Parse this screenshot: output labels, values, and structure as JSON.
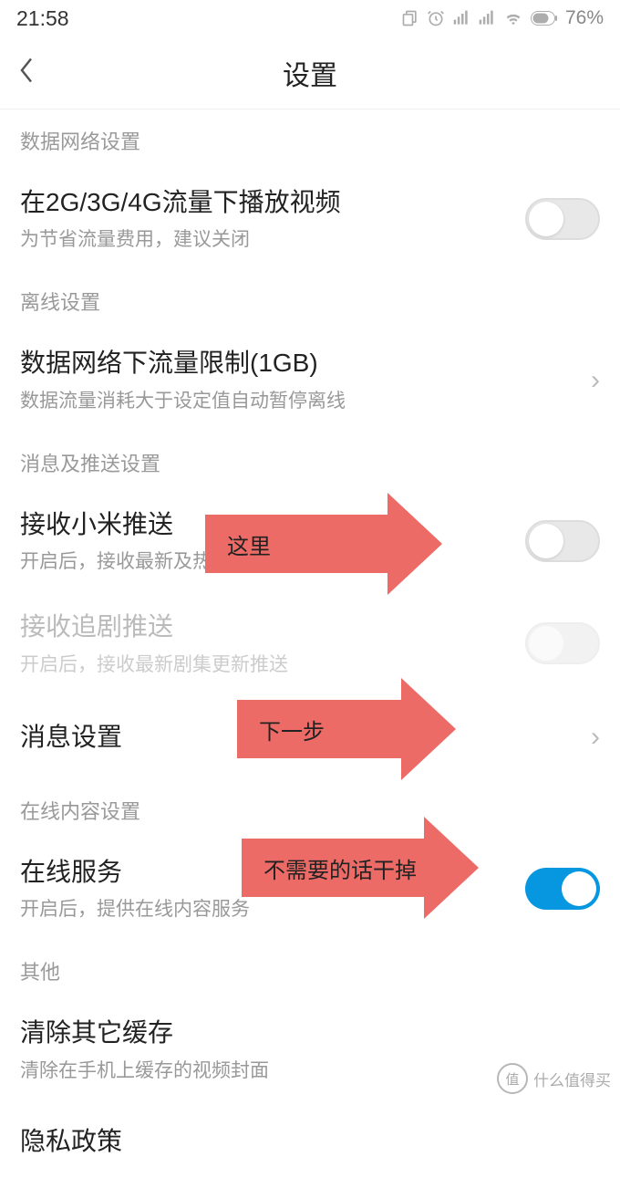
{
  "status": {
    "time": "21:58",
    "battery": "76%"
  },
  "header": {
    "title": "设置"
  },
  "sections": {
    "network": {
      "header": "数据网络设置",
      "mobile_play": {
        "title": "在2G/3G/4G流量下播放视频",
        "sub": "为节省流量费用，建议关闭"
      }
    },
    "offline": {
      "header": "离线设置",
      "data_limit": {
        "title": "数据网络下流量限制(1GB)",
        "sub": "数据流量消耗大于设定值自动暂停离线"
      }
    },
    "push": {
      "header": "消息及推送设置",
      "xiaomi": {
        "title": "接收小米推送",
        "sub": "开启后，接收最新及热门影片通知"
      },
      "drama": {
        "title": "接收追剧推送",
        "sub": "开启后，接收最新剧集更新推送"
      },
      "msg_settings": {
        "title": "消息设置"
      }
    },
    "online": {
      "header": "在线内容设置",
      "service": {
        "title": "在线服务",
        "sub": "开启后，提供在线内容服务"
      }
    },
    "other": {
      "header": "其他",
      "clear_cache": {
        "title": "清除其它缓存",
        "sub": "清除在手机上缓存的视频封面"
      },
      "privacy": {
        "title": "隐私政策"
      }
    }
  },
  "annotations": {
    "a1": "这里",
    "a2": "下一步",
    "a3": "不需要的话干掉"
  },
  "watermark": {
    "badge": "值",
    "text": "什么值得买"
  }
}
